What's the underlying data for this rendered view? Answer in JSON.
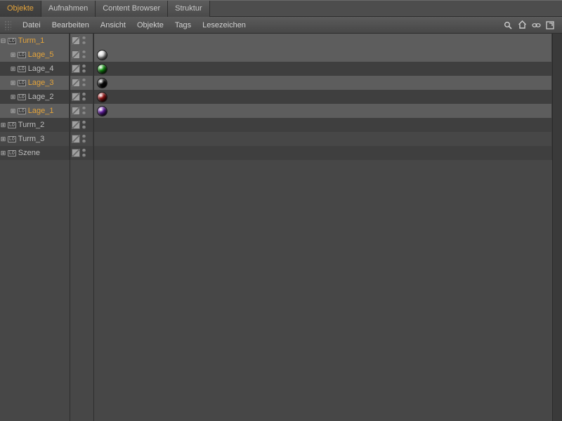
{
  "tabs": {
    "items": [
      {
        "label": "Objekte",
        "active": true
      },
      {
        "label": "Aufnahmen",
        "active": false
      },
      {
        "label": "Content Browser",
        "active": false
      },
      {
        "label": "Struktur",
        "active": false
      }
    ]
  },
  "menubar": {
    "items": [
      "Datei",
      "Bearbeiten",
      "Ansicht",
      "Objekte",
      "Tags",
      "Lesezeichen"
    ]
  },
  "toolbar_icons": {
    "search": "search-icon",
    "home": "home-icon",
    "link": "link-icon",
    "maximize": "maximize-icon"
  },
  "object_type_badge": "L0",
  "objects": [
    {
      "name": "Turm_1",
      "depth": 0,
      "expanded": true,
      "selected": true,
      "material": null
    },
    {
      "name": "Lage_5",
      "depth": 1,
      "expanded": false,
      "selected": true,
      "material": "#e8e8e8"
    },
    {
      "name": "Lage_4",
      "depth": 1,
      "expanded": false,
      "selected": false,
      "material": "#17a015"
    },
    {
      "name": "Lage_3",
      "depth": 1,
      "expanded": false,
      "selected": true,
      "material": "#0a0a0a"
    },
    {
      "name": "Lage_2",
      "depth": 1,
      "expanded": false,
      "selected": false,
      "material": "#a01515"
    },
    {
      "name": "Lage_1",
      "depth": 1,
      "expanded": false,
      "selected": true,
      "material": "#6a1fae"
    },
    {
      "name": "Turm_2",
      "depth": 0,
      "expanded": false,
      "selected": false,
      "material": null
    },
    {
      "name": "Turm_3",
      "depth": 0,
      "expanded": false,
      "selected": false,
      "material": null
    },
    {
      "name": "Szene",
      "depth": 0,
      "expanded": false,
      "selected": false,
      "material": null
    }
  ]
}
